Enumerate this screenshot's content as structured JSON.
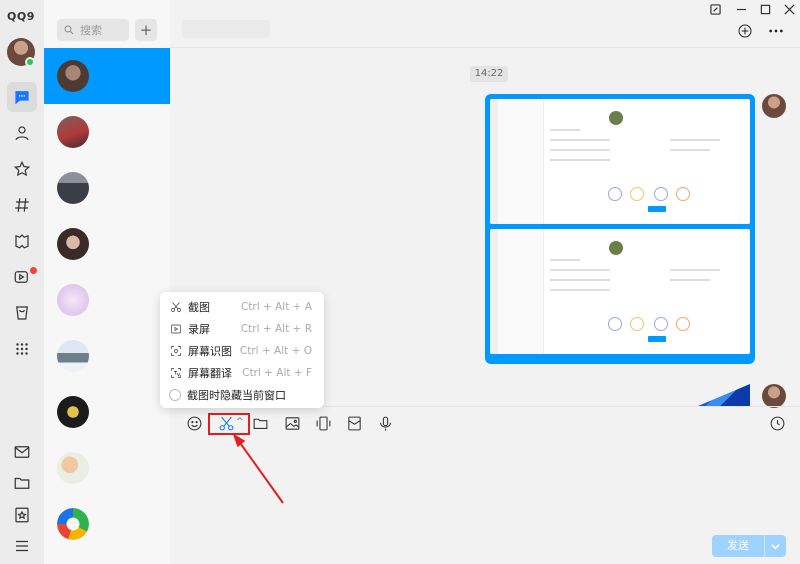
{
  "app": {
    "logo": "QQ9"
  },
  "colors": {
    "accent": "#0099ff",
    "send_disabled": "#9fd3ff",
    "annotation": "#e02020",
    "unread_dot": "#f44336"
  },
  "rail": {
    "items": [
      {
        "name": "chat-icon",
        "active": true
      },
      {
        "name": "contacts-icon"
      },
      {
        "name": "star-icon"
      },
      {
        "name": "hashtag-icon"
      },
      {
        "name": "game-icon"
      },
      {
        "name": "video-icon"
      },
      {
        "name": "store-icon"
      },
      {
        "name": "apps-grid-icon"
      }
    ],
    "bottom": [
      {
        "name": "mail-icon"
      },
      {
        "name": "folder-icon"
      },
      {
        "name": "favorites-icon"
      },
      {
        "name": "menu-icon"
      }
    ]
  },
  "list": {
    "search_placeholder": "搜索",
    "add_label": "+"
  },
  "chat": {
    "timestamp": "14:22",
    "send_label": "发送"
  },
  "menu": {
    "items": [
      {
        "label": "截图",
        "shortcut": "Ctrl + Alt + A",
        "icon": "scissors-icon"
      },
      {
        "label": "录屏",
        "shortcut": "Ctrl + Alt + R",
        "icon": "record-screen-icon"
      },
      {
        "label": "屏幕识图",
        "shortcut": "Ctrl + Alt + O",
        "icon": "screen-ocr-icon"
      },
      {
        "label": "屏幕翻译",
        "shortcut": "Ctrl + Alt + F",
        "icon": "screen-translate-icon"
      },
      {
        "label": "截图时隐藏当前窗口",
        "shortcut": "",
        "icon": "radio-icon"
      }
    ]
  }
}
